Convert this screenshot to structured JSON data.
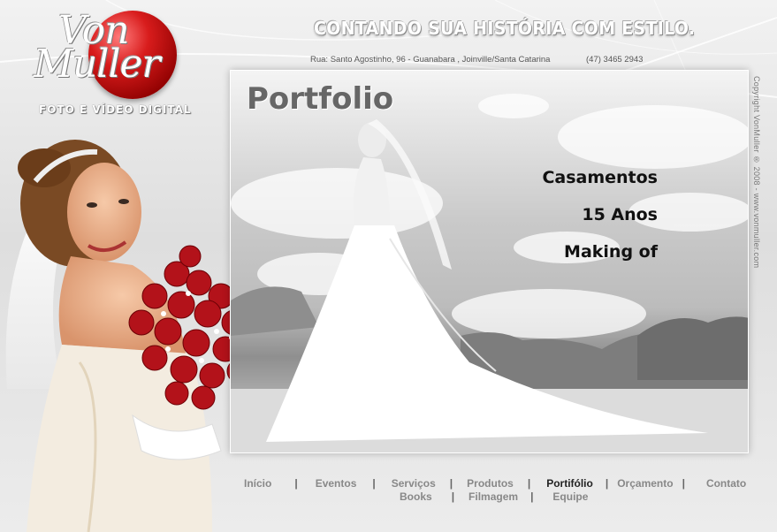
{
  "brand": {
    "logo_line1": "Von",
    "logo_line2": "Muller",
    "tagline": "FOTO E VÍDEO DIGITAL"
  },
  "header": {
    "slogan": "CONTANDO SUA HISTÓRIA COM ESTILO.",
    "address": "Rua: Santo Agostinho, 96 - Guanabara , Joinville/Santa Catarina",
    "phone": "(47) 3465 2943"
  },
  "panel": {
    "title": "Portfolio",
    "links": [
      "Casamentos",
      "15 Anos",
      "Making of"
    ]
  },
  "copyright": "Copyright VonMuller ® 2008 - www.vonmuller.com",
  "nav": {
    "row1": [
      "Início",
      "Eventos",
      "Serviços",
      "Produtos",
      "Portifólio",
      "Orçamento",
      "Contato"
    ],
    "row2": [
      "Books",
      "Filmagem",
      "Equipe"
    ],
    "separator": "|",
    "active": "Portifólio"
  },
  "colors": {
    "accent_red": "#c0141b",
    "nav_text": "#888888",
    "nav_active": "#222222"
  }
}
